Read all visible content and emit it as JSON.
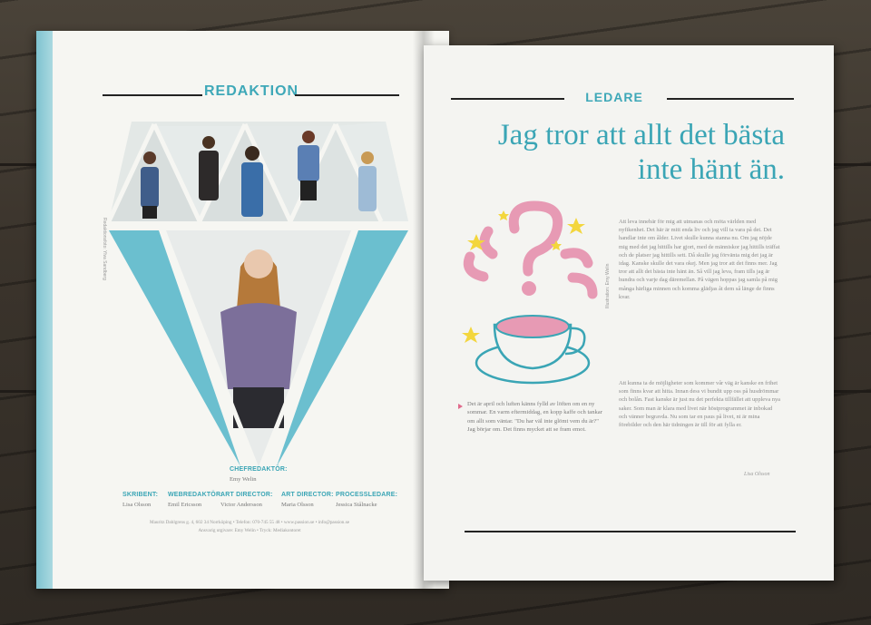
{
  "left_page": {
    "section_title": "REDAKTION",
    "photo_credit": "Redaktionsfoto: Ylva Sandberg",
    "staff": [
      {
        "role": "CHEFREDAKTÖR:",
        "name": "Emy Welin"
      },
      {
        "role": "SKRIBENT:",
        "name": "Lisa Olsson"
      },
      {
        "role": "WEBREDAKTÖR:",
        "name": "Emil Ericsson"
      },
      {
        "role": "ART DIRECTOR:",
        "name": "Victor Andersson"
      },
      {
        "role": "ART DIRECTOR:",
        "name": "Maria Olsson"
      },
      {
        "role": "PROCESSLEDARE:",
        "name": "Jessica Stålnacke"
      }
    ],
    "address_line_1": "Mauritz Dahlgrens g. 4, 602 34 Norrköping • Telefon: 070-745 55 48 • www.passion.se • info@passion.se",
    "address_line_2": "Ansvarig utgivare: Emy Welin • Tryck: Mediakontoret"
  },
  "right_page": {
    "section_title": "LEDARE",
    "headline_line_1": "Jag tror att allt det bästa",
    "headline_line_2": "inte hänt än.",
    "illustration_credit": "Illustration: Emy Welin",
    "intro": "Det är april och luften känns fylld av löften om en ny sommar. En varm eftermiddag, en kopp kaffe och tankar om allt som väntar. \"Du har väl inte glömt vem du är?\" Jag börjar om. Det finns mycket att se fram emot.",
    "body_p1": "Att leva innebär för mig att utmanas och möta världen med nyfikenhet. Det här är mitt enda liv och jag vill ta vara på det. Det handlar inte om ålder. Livet skulle kunna stanna nu. Om jag nöjde mig med det jag hittills har gjort, med de människor jag hittills träffat och de platser jag hittills sett. Då skulle jag förvänta mig det jag är idag. Kanske skulle det vara okej. Men jag tror att det finns mer. Jag tror att allt det bästa inte hänt än. Så vill jag leva, fram tills jag är hundra och varje dag däremellan. På vägen hoppas jag samla på mig många härliga minnen och komma glädjas åt dem så länge de finns kvar.",
    "body_p2": "Att kunna ta de möjligheter som kommer vår väg är kanske en frihet som finns kvar att hitta. Innan dess vi bundit upp oss på husdrömmar och bolån. Fast kanske är just nu det perfekta tillfället att uppleva nya saker. Som man är klara med livet när höstprogrammet är inbokad och vänner begravda. Nu som tar en paus på livet, ni är mina förebilder och den här tidningen är till för att fylla er.",
    "signature": "Lisa Olsson"
  },
  "colors": {
    "accent_teal": "#3aa5b5",
    "illustration_pink": "#e79ab4",
    "star_yellow": "#f3d63d"
  }
}
